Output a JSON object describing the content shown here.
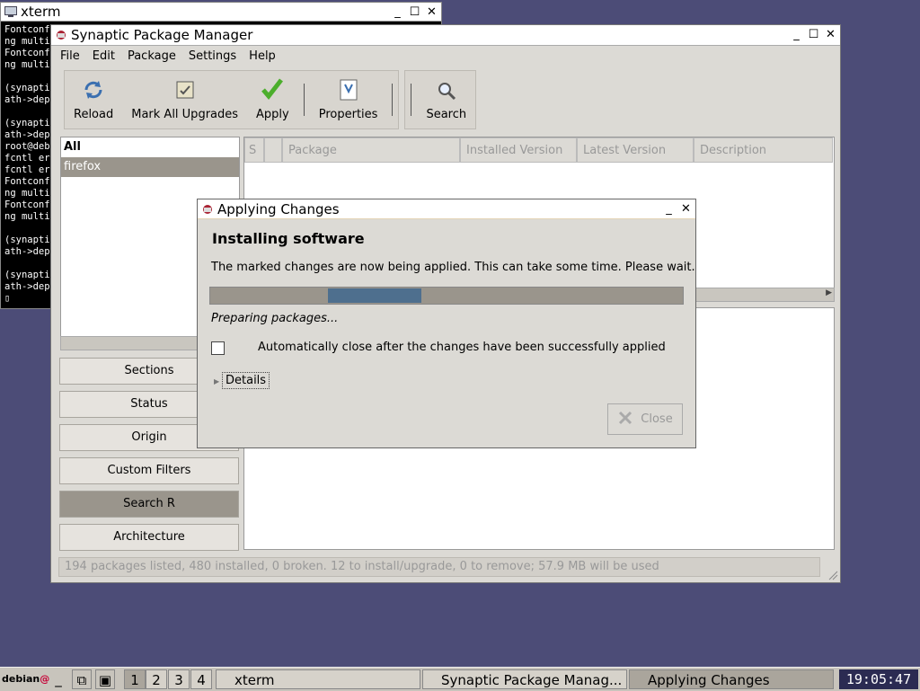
{
  "xterm": {
    "title": "xterm",
    "lines": [
      "Fontconf",
      "ng multi",
      "Fontconf",
      "ng multi",
      "",
      "(synapti",
      "ath->dep",
      "",
      "(synapti",
      "ath->dep",
      "root@deb",
      "fcntl er",
      "fcntl er",
      "Fontconf",
      "ng multi",
      "Fontconf",
      "ng multi",
      "",
      "(synapti",
      "ath->dep",
      "",
      "(synapti",
      "ath->dep",
      "▯"
    ]
  },
  "synaptic": {
    "title": "Synaptic Package Manager",
    "menu": [
      "File",
      "Edit",
      "Package",
      "Settings",
      "Help"
    ],
    "toolbar": {
      "reload": "Reload",
      "mark_all": "Mark All Upgrades",
      "apply": "Apply",
      "properties": "Properties",
      "search": "Search"
    },
    "filters": {
      "all": "All",
      "firefox": "firefox"
    },
    "left_buttons": [
      "Sections",
      "Status",
      "Origin",
      "Custom Filters",
      "Search R",
      "Architecture"
    ],
    "columns": {
      "s": "S",
      "package": "Package",
      "installed": "Installed Version",
      "latest": "Latest Version",
      "description": "Description"
    },
    "status": "194 packages listed, 480 installed, 0 broken. 12 to install/upgrade, 0 to remove; 57.9 MB will be used"
  },
  "dialog": {
    "title": "Applying Changes",
    "heading": "Installing software",
    "message": "The marked changes are now being applied. This can take some time. Please wait.",
    "progress_status": "Preparing packages...",
    "auto_close_label": "Automatically close after the changes have been successfully applied",
    "auto_close_checked": false,
    "details_label": "Details",
    "close_label": "Close"
  },
  "taskbar": {
    "logo": "debian",
    "desktops": [
      "1",
      "2",
      "3",
      "4"
    ],
    "active_desktop": "1",
    "tasks": [
      "xterm",
      "Synaptic Package Manag...",
      "Applying Changes"
    ],
    "clock": "19:05:47"
  },
  "colors": {
    "desktop": "#4c4c77",
    "window": "#dcdad5",
    "selection": "#9a958c",
    "progress": "#4e6f8e"
  }
}
